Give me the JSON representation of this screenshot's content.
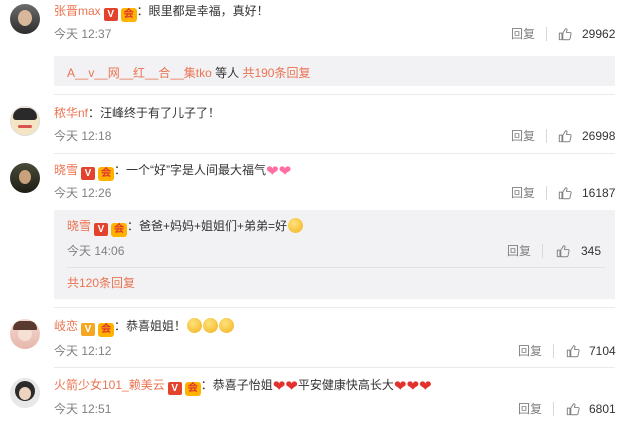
{
  "comments": [
    {
      "username": "张晋max",
      "text": "：眼里都是幸福，真好！",
      "time": "今天 12:37",
      "reply_label": "回复",
      "likes": "29962",
      "sub_reply_users": "A__v__网__红__合__集tko",
      "sub_reply_suffix": " 等人 ",
      "sub_reply_count": "共190条回复"
    },
    {
      "username": "秾华nf",
      "text": "：汪峰终于有了儿子了！",
      "time": "今天 12:18",
      "reply_label": "回复",
      "likes": "26998"
    },
    {
      "username": "晓雪",
      "text": "：一个“好”字是人间最大福气",
      "time": "今天 12:26",
      "reply_label": "回复",
      "likes": "16187",
      "reply": {
        "username": "晓雪",
        "text": "：爸爸+妈妈+姐姐们+弟弟=好",
        "time": "今天 14:06",
        "reply_label": "回复",
        "likes": "345"
      },
      "more_replies": "共120条回复"
    },
    {
      "username": "岐恋",
      "text": "：恭喜姐姐！",
      "time": "今天 12:12",
      "reply_label": "回复",
      "likes": "7104"
    },
    {
      "username": "火箭少女101_赖美云",
      "text": "：恭喜子怡姐",
      "text2": "平安健康快高长大",
      "time": "今天 12:51",
      "reply_label": "回复",
      "likes": "6801"
    }
  ],
  "badges": {
    "verified": "V",
    "vip": "会"
  },
  "colors": {
    "username": "#eb7350",
    "meta": "#808080",
    "sub_bg": "#f2f2f5"
  }
}
